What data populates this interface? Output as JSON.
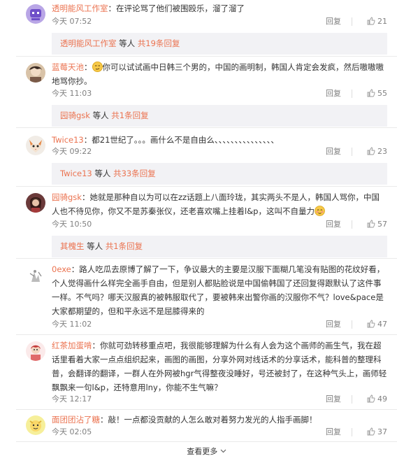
{
  "comments": [
    {
      "username": "透明能风工作室",
      "text": "：在评论骂了他们被围殴乐，溜了溜了",
      "time": "今天 07:52",
      "reply": "回复",
      "likes": "21",
      "sub": {
        "name": "透明能风工作室",
        "mid": " 等人 ",
        "count": "共19条回复"
      }
    },
    {
      "username": "蓝莓天池",
      "text_before_emoji": "：",
      "emoji": "smirk-emoji",
      "text": "你可以试试画中日韩三个男的，中国的画明制，韩国人肯定会发疯，然后嗷嗷嗷地骂你抄。",
      "time": "今天 11:03",
      "reply": "回复",
      "likes": "55",
      "sub": {
        "name": "园骑gsk",
        "mid": " 等人 ",
        "count": "共1条回复"
      }
    },
    {
      "username": "Twice13",
      "text": "：都21世纪了。。。画什么不是自由么、、、、、、、、、、、、、、、",
      "time": "今天 09:22",
      "reply": "回复",
      "likes": "23",
      "sub": {
        "name": "Twice13",
        "mid": " 等人 ",
        "count": "共33条回复"
      }
    },
    {
      "username": "园骑gsk",
      "text": "：她就是那种自以为可以在zz话题上八面玲珑，其实两头不是人，韩国人骂你，中国人也不待见你，你又不是苏秦张仪，还老喜欢嘴上挂着l&p，这叫不自量力",
      "emoji": "blush-emoji",
      "time": "今天 10:50",
      "reply": "回复",
      "likes": "57",
      "sub": {
        "name": "其槐生",
        "mid": " 等人 ",
        "count": "共1条回复"
      }
    },
    {
      "username": "0exe",
      "text": "：路人吃瓜去原博了解了一下，争议最大的主要是汉服下面糊几笔没有贴图的花纹好看，个人觉得画什么样完全画手自由，但是别人都贴脸说是中国偷韩国了还回复得跟默认了这件事一样。不气吗？哪天汉服真的被韩服取代了，要被韩来出警你画的汉服你不气？love&pace是大家都期望的，但和平永远不是屈膝得来的",
      "time": "今天 11:02",
      "reply": "回复",
      "likes": "47"
    },
    {
      "username": "红茶加蛋啃",
      "text": "：你就可劲转移重点吧，我很能够理解为什么有人会为这个画师的画生气，我在超话里看着大家一点点组织起来，画图的画图，分享外网对线话术的分享话术，能科普的整理科普，会翻译的翻译，一群人在外网被hgr气得整夜没睡好，号还被封了，在这种气头上，画师轻飘飘来一句l&p，还特意用lny，你能不生气嘛？",
      "time": "今天 12:17",
      "reply": "回复",
      "likes": "49"
    },
    {
      "username": "面团团沾了糖",
      "text": "：敲！一点都没贡献的人怎么敢对着努力发光的人指手画脚！",
      "time": "今天 02:05",
      "reply": "回复",
      "likes": "37"
    }
  ],
  "more_label": "查看更多",
  "colors": {
    "username": "#eb7350",
    "meta": "#808080",
    "subbox_bg": "#f2f2f5"
  }
}
